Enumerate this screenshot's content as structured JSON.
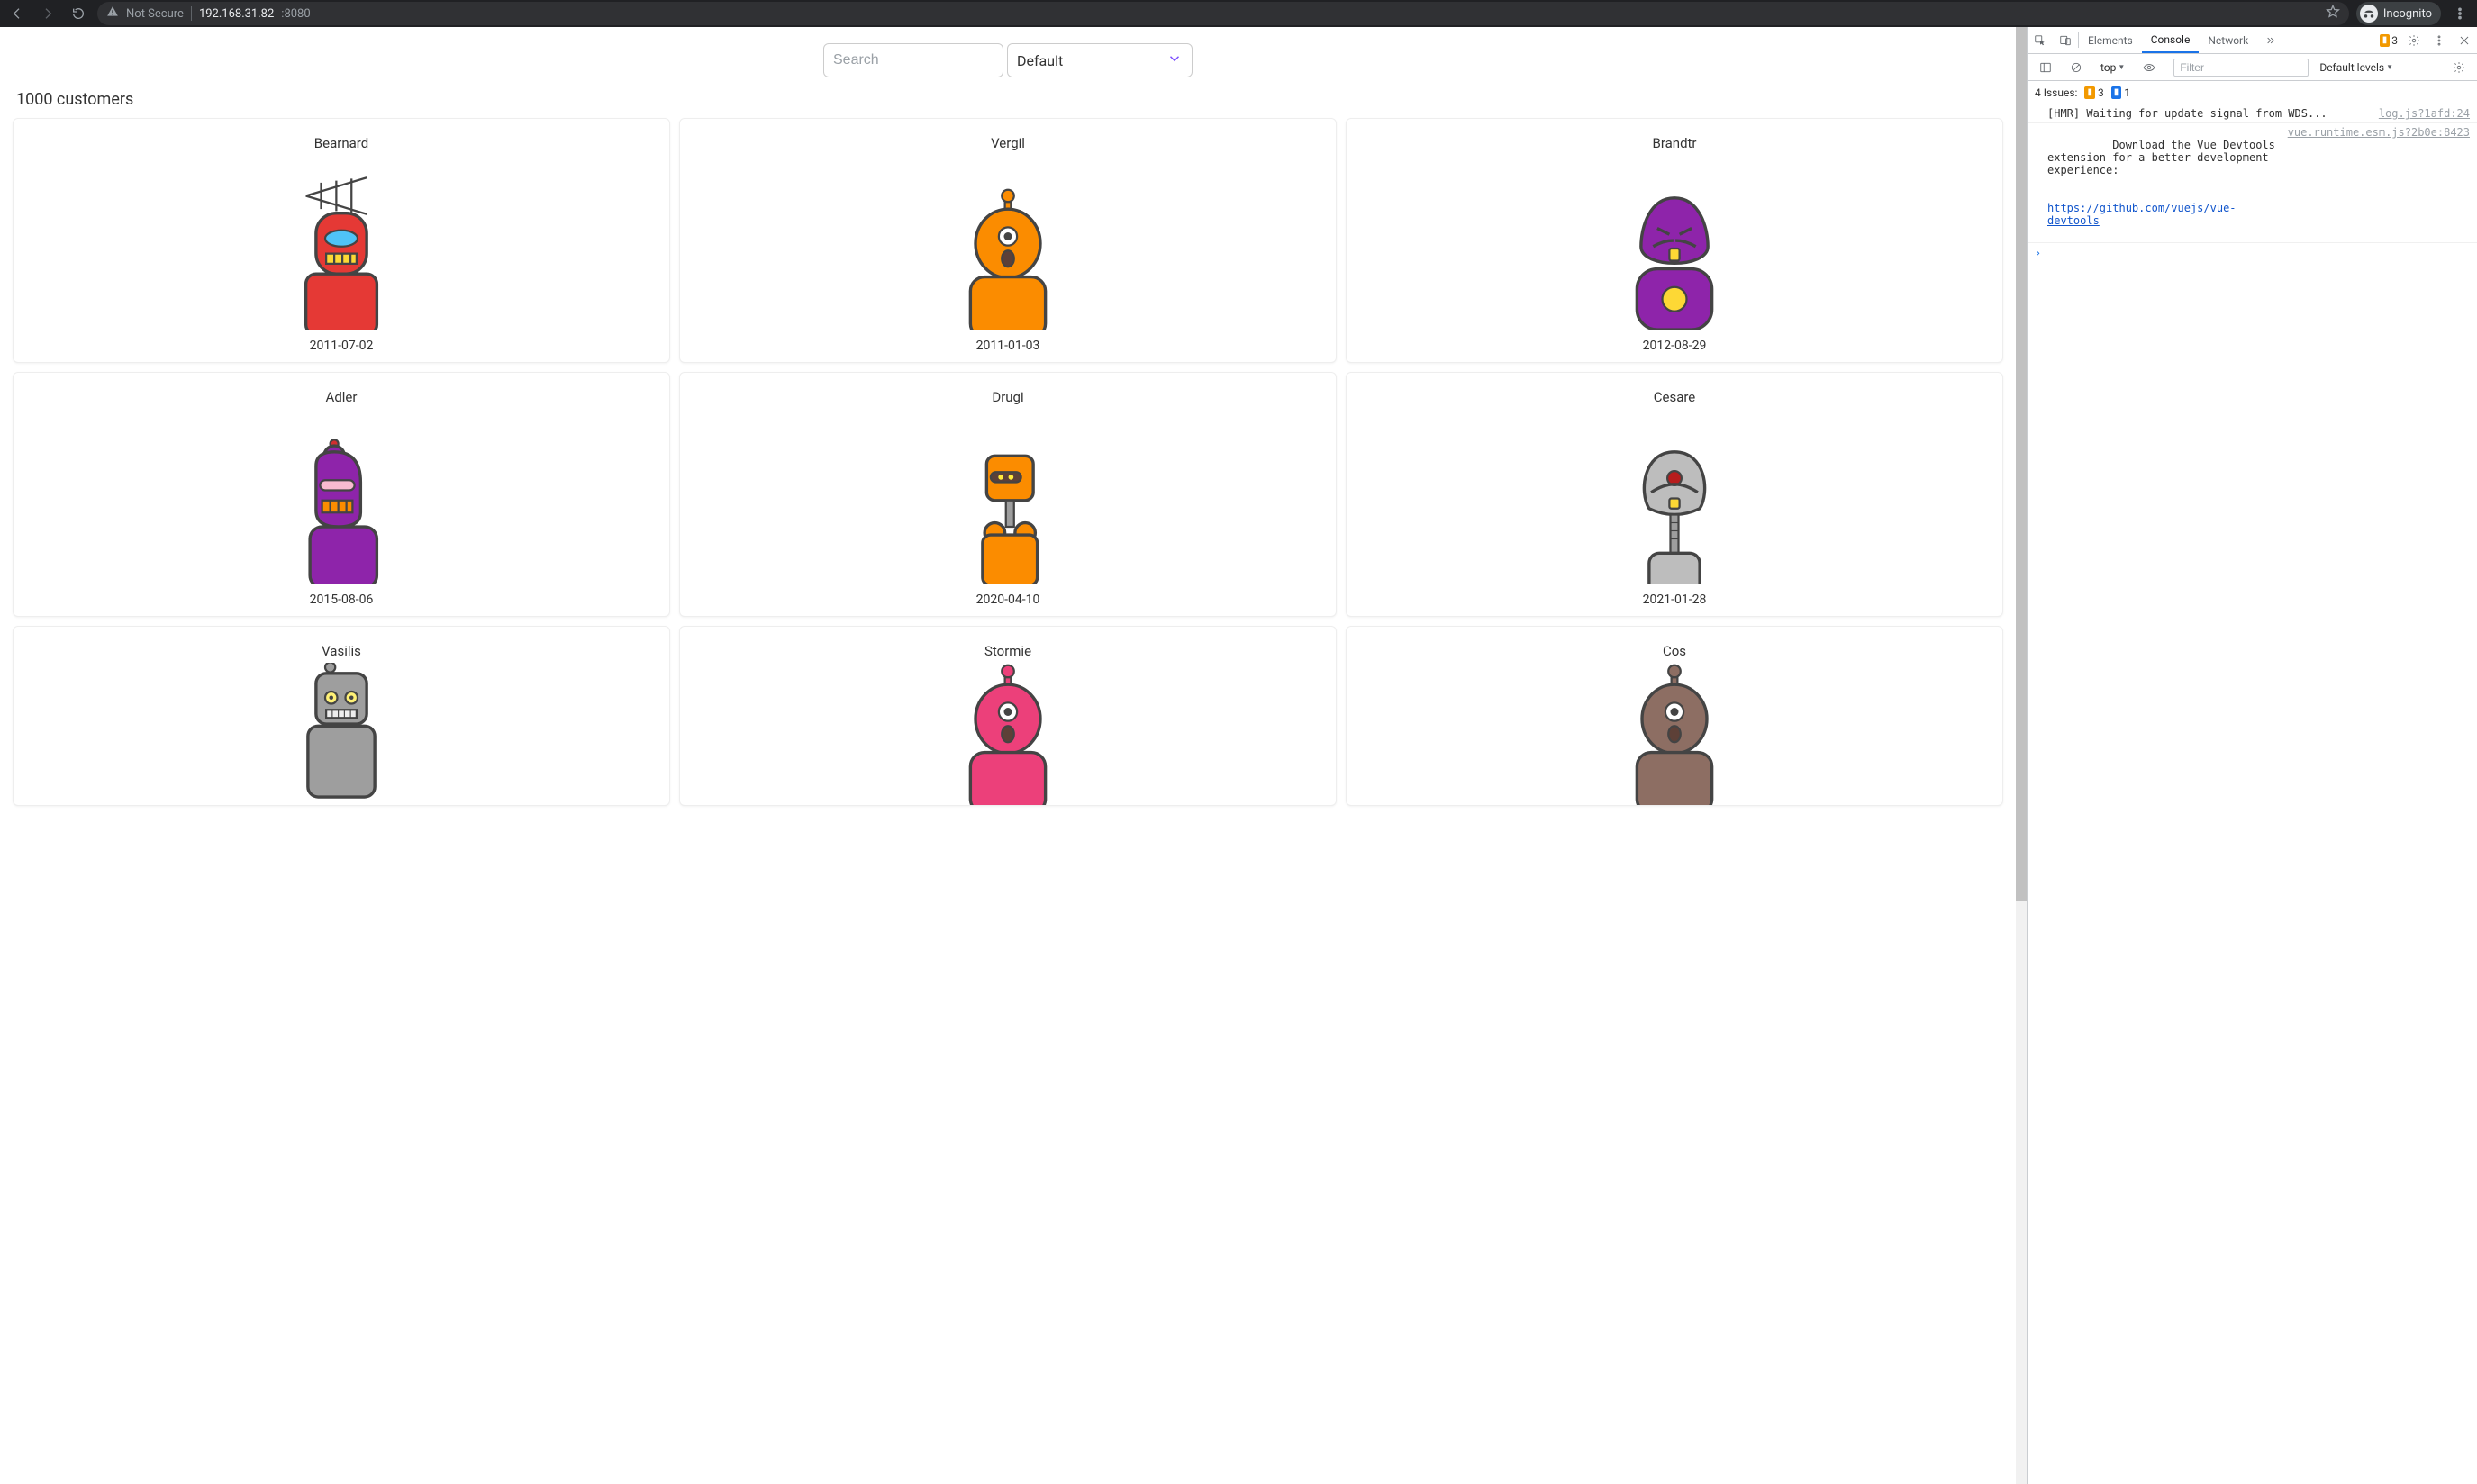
{
  "browser": {
    "not_secure": "Not Secure",
    "url_host": "192.168.31.82",
    "url_port": ":8080",
    "incognito_label": "Incognito"
  },
  "page": {
    "search_placeholder": "Search",
    "sort_value": "Default",
    "count_label": "1000 customers",
    "customers": [
      {
        "name": "Bearnard",
        "date": "2011-07-02",
        "color": "#e53935",
        "variant": "antenna"
      },
      {
        "name": "Vergil",
        "date": "2011-01-03",
        "color": "#fb8c00",
        "variant": "cyclops"
      },
      {
        "name": "Brandtr",
        "date": "2012-08-29",
        "color": "#8e24aa",
        "variant": "grumpy"
      },
      {
        "name": "Adler",
        "date": "2015-08-06",
        "color": "#8e24aa",
        "variant": "visor"
      },
      {
        "name": "Drugi",
        "date": "2020-04-10",
        "color": "#fb8c00",
        "variant": "boxhead"
      },
      {
        "name": "Cesare",
        "date": "2021-01-28",
        "color": "#bdbdbd",
        "variant": "dish"
      },
      {
        "name": "Vasilis",
        "date": "",
        "color": "#9e9e9e",
        "variant": "classic"
      },
      {
        "name": "Stormie",
        "date": "",
        "color": "#ec407a",
        "variant": "cyclops"
      },
      {
        "name": "Cos",
        "date": "",
        "color": "#8d6e63",
        "variant": "cyclops"
      }
    ]
  },
  "devtools": {
    "tabs": {
      "elements": "Elements",
      "console": "Console",
      "network": "Network"
    },
    "warn_count": "3",
    "toolbar": {
      "context": "top",
      "filter_placeholder": "Filter",
      "levels": "Default levels"
    },
    "issues": {
      "label": "4 Issues:",
      "warn": "3",
      "info": "1"
    },
    "logs": [
      {
        "msg": "[HMR] Waiting for update signal from WDS...",
        "src": "log.js?1afd:24"
      },
      {
        "msg_parts": [
          "Download the Vue Devtools extension for a better development experience:",
          "https://github.com/vuejs/vue-devtools"
        ],
        "src": "vue.runtime.esm.js?2b0e:8423"
      }
    ]
  }
}
